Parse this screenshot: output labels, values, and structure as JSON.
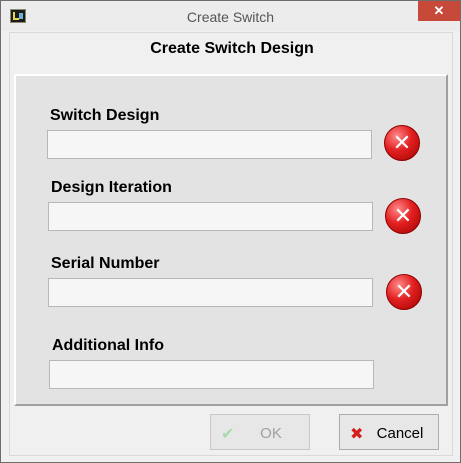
{
  "window": {
    "title": "Create Switch",
    "close_glyph": "✕",
    "icon": "labview-app-icon"
  },
  "dialog": {
    "heading": "Create Switch Design"
  },
  "fields": [
    {
      "label": "Switch Design",
      "value": "",
      "error": true,
      "error_icon": "error-x-icon",
      "error_glyph": "✕"
    },
    {
      "label": "Design Iteration",
      "value": "",
      "error": true,
      "error_icon": "error-x-icon",
      "error_glyph": "✕"
    },
    {
      "label": "Serial Number",
      "value": "",
      "error": true,
      "error_icon": "error-x-icon",
      "error_glyph": "✕"
    },
    {
      "label": "Additional Info",
      "value": "",
      "error": false
    }
  ],
  "buttons": {
    "ok": {
      "label": "OK",
      "icon": "checkmark-icon",
      "glyph": "✔",
      "enabled": false
    },
    "cancel": {
      "label": "Cancel",
      "icon": "cancel-x-icon",
      "glyph": "✖",
      "enabled": true
    }
  },
  "colors": {
    "error_red": "#e22020",
    "close_button": "#c7493a",
    "panel_bg": "#e3e3e3"
  }
}
